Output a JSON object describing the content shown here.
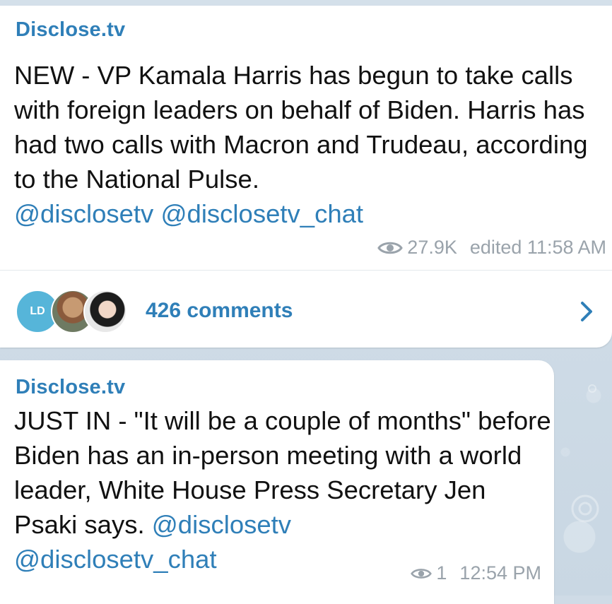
{
  "posts": [
    {
      "sender": "Disclose.tv",
      "text": "NEW - VP Kamala Harris has begun to take calls with foreign leaders on behalf of Biden. Harris has had two calls with Macron and Trudeau, according to the National Pulse.",
      "mentions": [
        "@disclosetv",
        "@disclosetv_chat"
      ],
      "views": "27.9K",
      "time": "edited 11:58 AM",
      "comments": {
        "count_label": "426 comments",
        "avatar_initials": "LD"
      }
    },
    {
      "sender": "Disclose.tv",
      "text": "JUST IN - \"It will be a couple of months\" before Biden has an in-person meeting with a world leader, White House Press Secretary Jen Psaki says.",
      "mentions": [
        "@disclosetv",
        "@disclosetv_chat"
      ],
      "views": "1",
      "time": "12:54 PM"
    }
  ],
  "colors": {
    "accent": "#2f7fb8",
    "meta": "#9aa3ab",
    "avatar_ld": "#56b5d9",
    "background": "#cfdbe6"
  },
  "icons": {
    "views": "eye-icon",
    "open_comments": "chevron-right-icon"
  }
}
